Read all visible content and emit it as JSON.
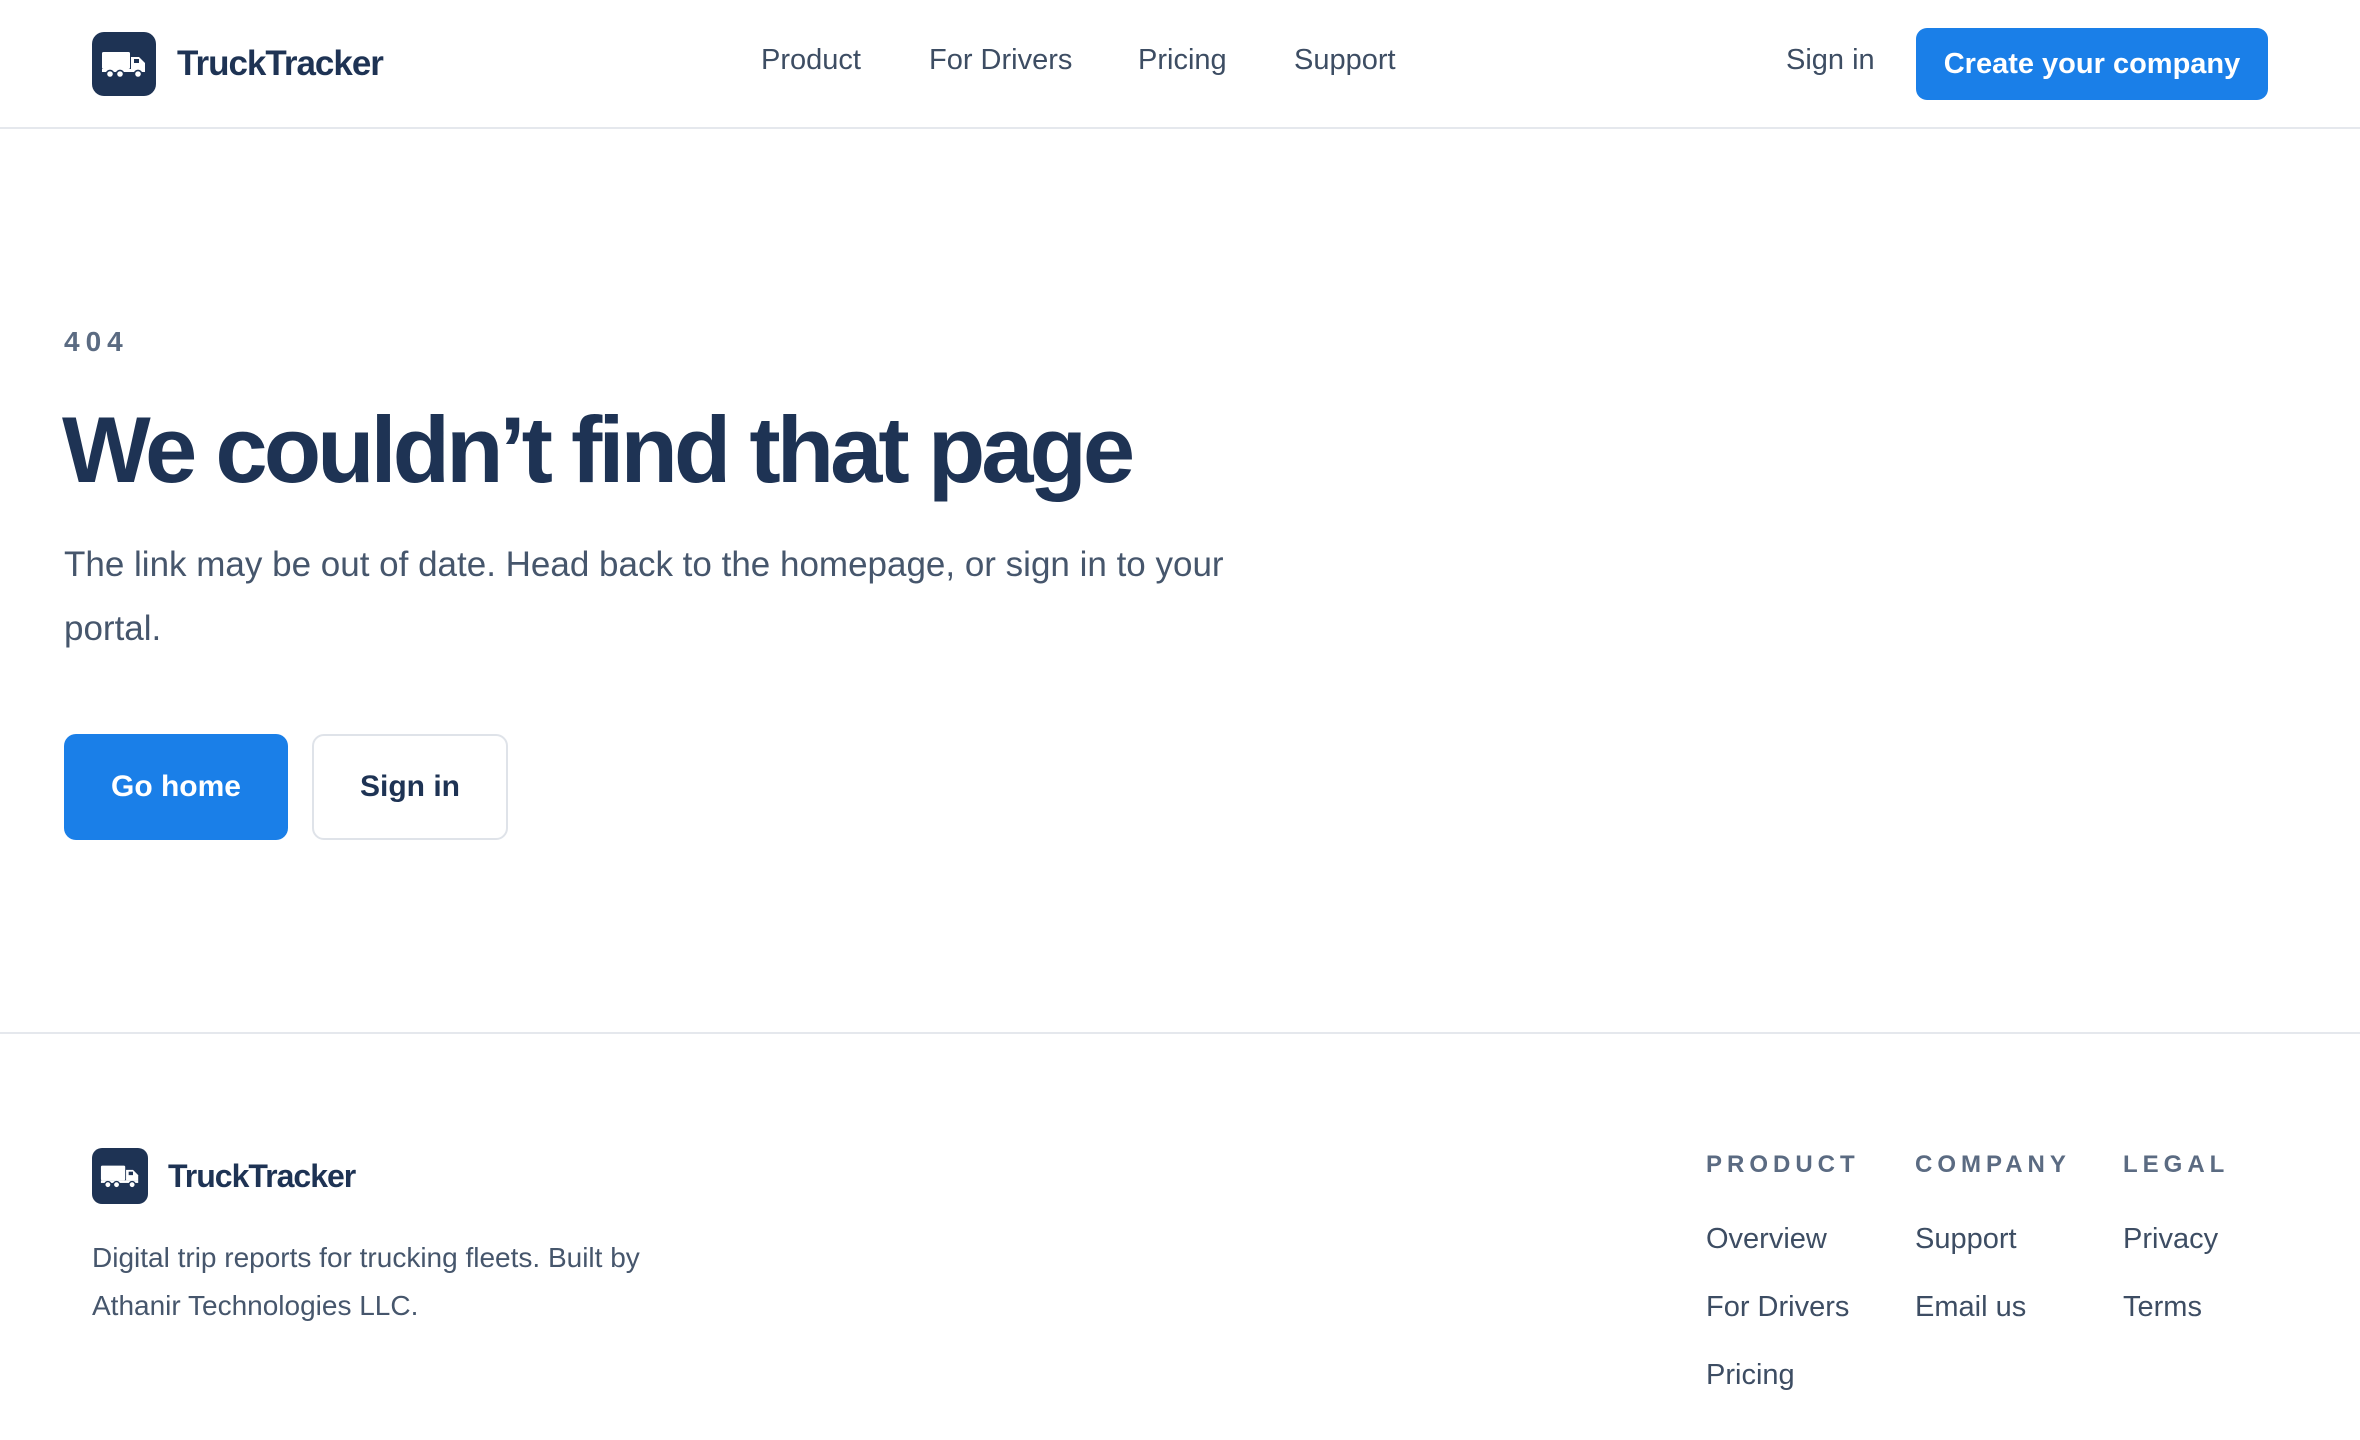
{
  "brand": {
    "name": "TruckTracker",
    "logo_icon": "truck-icon"
  },
  "header": {
    "nav": [
      {
        "label": "Product"
      },
      {
        "label": "For Drivers"
      },
      {
        "label": "Pricing"
      },
      {
        "label": "Support"
      }
    ],
    "sign_in_label": "Sign in",
    "cta_label": "Create your company"
  },
  "hero": {
    "eyebrow": "404",
    "title": "We couldn’t find that page",
    "description": "The link may be out of date. Head back to the homepage, or sign in to your portal.",
    "primary_button": "Go home",
    "secondary_button": "Sign in"
  },
  "footer": {
    "brand_name": "TruckTracker",
    "tagline": "Digital trip reports for trucking fleets. Built by Athanir Technologies LLC.",
    "columns": [
      {
        "heading": "PRODUCT",
        "links": [
          "Overview",
          "For Drivers",
          "Pricing"
        ]
      },
      {
        "heading": "COMPANY",
        "links": [
          "Support",
          "Email us"
        ]
      },
      {
        "heading": "LEGAL",
        "links": [
          "Privacy",
          "Terms"
        ]
      }
    ]
  },
  "colors": {
    "brand_navy": "#1e3354",
    "accent_blue": "#1a7fe8",
    "text_muted": "#5b6b82",
    "border": "#e5e8ed"
  }
}
